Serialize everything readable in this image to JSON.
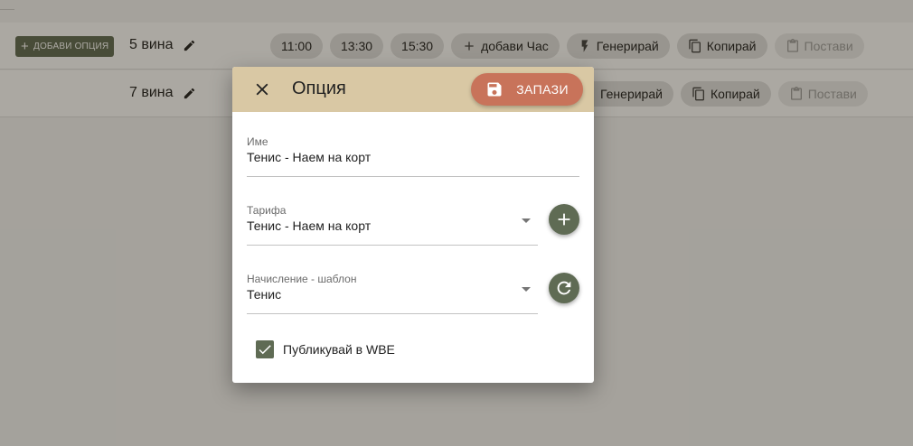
{
  "rows": [
    {
      "add_option_label": "ДОБАВИ ОПЦИЯ",
      "wines": "5 вина",
      "chips": [
        {
          "label": "11:00",
          "icon": "",
          "disabled": false
        },
        {
          "label": "13:30",
          "icon": "",
          "disabled": false
        },
        {
          "label": "15:30",
          "icon": "",
          "disabled": false
        },
        {
          "label": "добави Час",
          "icon": "plus-icon",
          "disabled": false
        },
        {
          "label": "Генерирай",
          "icon": "lightning-icon",
          "disabled": false
        },
        {
          "label": "Копирай",
          "icon": "copy-icon",
          "disabled": false
        },
        {
          "label": "Постави",
          "icon": "paste-icon",
          "disabled": true
        }
      ]
    },
    {
      "wines": "7 вина",
      "chips": [
        {
          "label": "Генерирай",
          "icon": "lightning-icon",
          "disabled": false
        },
        {
          "label": "Копирай",
          "icon": "copy-icon",
          "disabled": false
        },
        {
          "label": "Постави",
          "icon": "paste-icon",
          "disabled": true
        }
      ]
    }
  ],
  "dialog": {
    "title": "Опция",
    "save_label": "ЗАПАЗИ",
    "name_field": {
      "label": "Име",
      "value": "Тенис - Наем на корт"
    },
    "tariff_field": {
      "label": "Тарифа",
      "value": "Тенис - Наем на корт"
    },
    "calc_field": {
      "label": "Начисление - шаблон",
      "value": "Тенис"
    },
    "publish_label": "Публикувай в WBE",
    "publish_checked": true
  },
  "colors": {
    "accent_green": "#5f6b54",
    "header_beige": "#d9c8a4",
    "save_orange": "#c8735a"
  }
}
